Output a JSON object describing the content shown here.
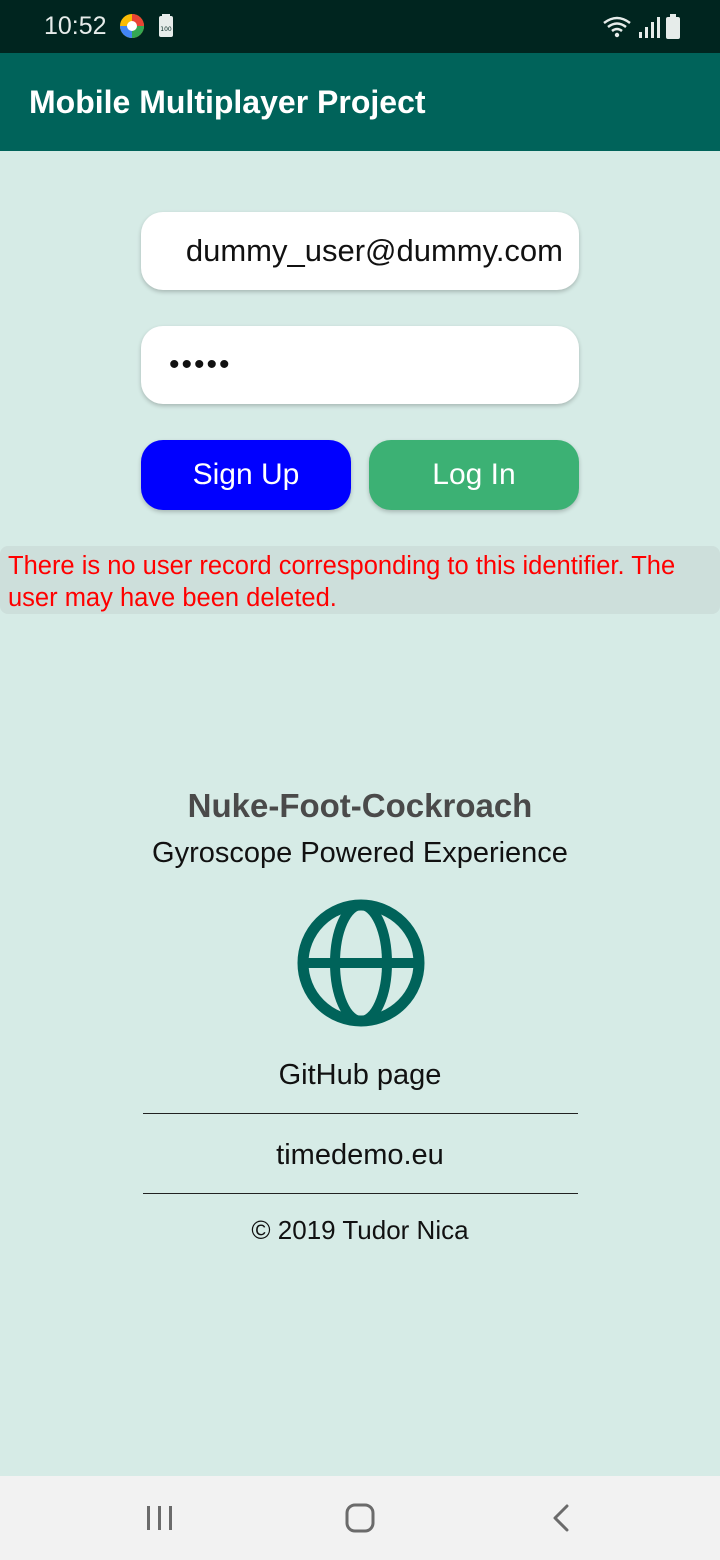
{
  "status_bar": {
    "time": "10:52",
    "icons": [
      "app-notification-icon",
      "storage-icon",
      "wifi-icon",
      "signal-icon",
      "battery-icon"
    ],
    "storage_badge": "100"
  },
  "app_bar": {
    "title": "Mobile Multiplayer Project",
    "color": "#00635a"
  },
  "login_form": {
    "email_value": "dummy_user@dummy.com",
    "password_value": "•••••",
    "signup_label": "Sign Up",
    "login_label": "Log In",
    "signup_color": "#0000ff",
    "login_color": "#3cb174"
  },
  "error": {
    "message": "There is no user record corresponding to this identifier. The user may have been deleted.",
    "color": "#ff0000"
  },
  "branding": {
    "title": "Nuke-Foot-Cockroach",
    "subtitle": "Gyroscope Powered Experience",
    "icon": "globe-icon"
  },
  "links": {
    "github": "GitHub page",
    "website": "timedemo.eu"
  },
  "footer": {
    "copyright": "© 2019 Tudor Nica"
  },
  "nav_bar": {
    "buttons": [
      "recents-icon",
      "home-icon",
      "back-icon"
    ]
  }
}
